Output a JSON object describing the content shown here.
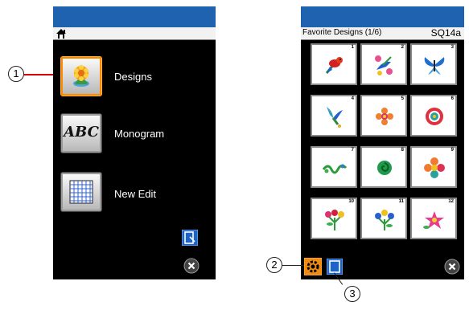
{
  "left_screen": {
    "menu": [
      {
        "label": "Designs",
        "icon": "flower-icon",
        "selected": true
      },
      {
        "label": "Monogram",
        "icon": "monogram-icon",
        "icon_text": "ABC",
        "selected": false
      },
      {
        "label": "New Edit",
        "icon": "grid-edit-icon",
        "selected": false
      }
    ],
    "bottom_icons": [
      "edit-screen-icon",
      "close-icon"
    ]
  },
  "right_screen": {
    "title": "Favorite Designs (1/6)",
    "code": "SQ14a",
    "tiles": [
      {
        "number": "1",
        "icon": "parrot-icon"
      },
      {
        "number": "2",
        "icon": "bird-flower-icon"
      },
      {
        "number": "3",
        "icon": "butterfly-icon"
      },
      {
        "number": "4",
        "icon": "hummingbird-icon"
      },
      {
        "number": "5",
        "icon": "small-flower-icon"
      },
      {
        "number": "6",
        "icon": "round-flower-icon"
      },
      {
        "number": "7",
        "icon": "swirl-vine-icon"
      },
      {
        "number": "8",
        "icon": "green-swirl-icon"
      },
      {
        "number": "9",
        "icon": "pinwheel-flower-icon"
      },
      {
        "number": "10",
        "icon": "flower-bouquet-icon"
      },
      {
        "number": "11",
        "icon": "blue-flowers-icon"
      },
      {
        "number": "12",
        "icon": "pink-lily-icon"
      }
    ],
    "bottom_icons": [
      "settings-icon",
      "edit-screen-icon",
      "close-icon"
    ]
  },
  "callouts": [
    "1",
    "2",
    "3"
  ],
  "colors": {
    "title_bar": "#1f63b0",
    "selected_border": "#ff8a00",
    "screen_bg": "#000000",
    "callout_line_red": "#d40000"
  }
}
